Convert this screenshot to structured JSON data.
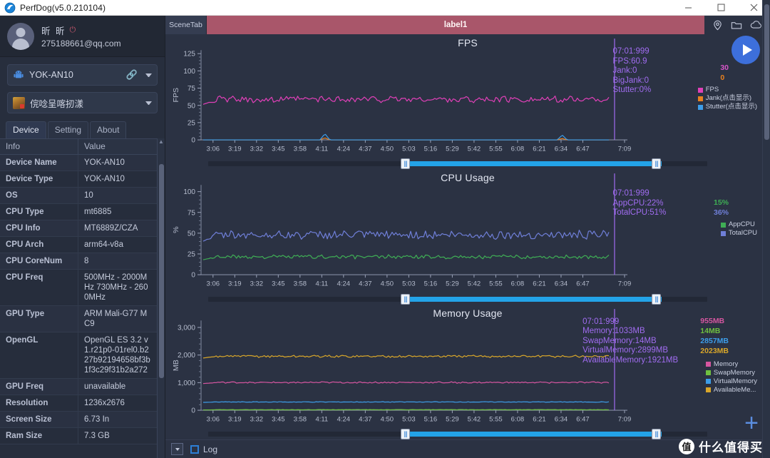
{
  "window": {
    "title": "PerfDog(v5.0.210104)",
    "minimize": "─",
    "maximize": "□",
    "close": "✕"
  },
  "sidebar": {
    "account": {
      "name": "昕 昕",
      "power_icon": "⏻",
      "email": "275188661@qq.com"
    },
    "device_select": {
      "label": "YOK-AN10",
      "link_icon": "🔗",
      "icon": "android-icon"
    },
    "app_select": {
      "label": "俒唸呈喀扨漾",
      "icon": "app-icon"
    },
    "tabs": [
      {
        "label": "Device",
        "active": true
      },
      {
        "label": "Setting",
        "active": false
      },
      {
        "label": "About",
        "active": false
      }
    ],
    "table": {
      "headers": [
        "Info",
        "Value"
      ],
      "rows": [
        {
          "info": "Device Name",
          "value": "YOK-AN10"
        },
        {
          "info": "Device Type",
          "value": "YOK-AN10"
        },
        {
          "info": "OS",
          "value": "10"
        },
        {
          "info": "CPU Type",
          "value": "mt6885"
        },
        {
          "info": "CPU Info",
          "value": "MT6889Z/CZA"
        },
        {
          "info": "CPU Arch",
          "value": "arm64-v8a"
        },
        {
          "info": "CPU CoreNum",
          "value": "8"
        },
        {
          "info": "CPU Freq",
          "value": "500MHz - 2000MHz 730MHz - 2600MHz"
        },
        {
          "info": "GPU Type",
          "value": "ARM Mali-G77 MC9"
        },
        {
          "info": "OpenGL",
          "value": "OpenGL ES 3.2 v1.r21p0-01rel0.b227b92194658bf3b1f3c29f31b2a272"
        },
        {
          "info": "GPU Freq",
          "value": "unavailable"
        },
        {
          "info": "Resolution",
          "value": "1236x2676"
        },
        {
          "info": "Screen Size",
          "value": "6.73 In"
        },
        {
          "info": "Ram Size",
          "value": "7.3 GB"
        }
      ]
    }
  },
  "main": {
    "scene_tab": "SceneTab",
    "label_tab": "label1",
    "toolbar_icons": [
      "location-icon",
      "folder-icon",
      "cloud-icon"
    ],
    "play_button": "play-icon",
    "add_button": "+"
  },
  "statusbar": {
    "dropdown": "dropdown-icon",
    "log_label": "Log",
    "log_checked": false
  },
  "watermark": {
    "mark": "值",
    "text": "什么值得买"
  },
  "chart_data": [
    {
      "type": "line",
      "title": "FPS",
      "ylabel": "FPS",
      "xlabel": "",
      "ylim": [
        0,
        130
      ],
      "yticks": [
        0,
        25,
        50,
        75,
        100,
        125
      ],
      "xticks": [
        "3:06",
        "3:19",
        "3:32",
        "3:45",
        "3:58",
        "4:11",
        "4:24",
        "4:37",
        "4:50",
        "5:03",
        "5:16",
        "5:29",
        "5:42",
        "5:55",
        "6:08",
        "6:21",
        "6:34",
        "6:47",
        "7:09"
      ],
      "cursor": {
        "lines": [
          "07:01:999",
          "FPS:60.9",
          "Jank:0",
          "BigJank:0",
          "Stutter:0%"
        ],
        "color": "#a06cf0"
      },
      "legend_values": [
        {
          "text": "30",
          "color": "#d556c8"
        },
        {
          "text": "0",
          "color": "#e8811f"
        }
      ],
      "legend": [
        {
          "name": "FPS",
          "color": "#e040b8"
        },
        {
          "name": "Jank(点击显示)",
          "color": "#e8811f"
        },
        {
          "name": "Stutter(点击显示)",
          "color": "#3d9de8"
        }
      ],
      "series": [
        {
          "name": "FPS",
          "color": "#e040b8",
          "mean": 58.5,
          "min": 52,
          "max": 62
        },
        {
          "name": "Jank",
          "color": "#e8811f",
          "mean": 0,
          "spikes": [
            {
              "x": 0.3,
              "y": 3
            },
            {
              "x": 0.885,
              "y": 2
            }
          ]
        },
        {
          "name": "Stutter",
          "color": "#3d9de8",
          "mean": 0,
          "spikes": [
            {
              "x": 0.3,
              "y": 9
            },
            {
              "x": 0.885,
              "y": 7
            }
          ]
        }
      ]
    },
    {
      "type": "line",
      "title": "CPU Usage",
      "ylabel": "%",
      "xlabel": "",
      "ylim": [
        0,
        108
      ],
      "yticks": [
        0,
        25,
        50,
        75,
        100
      ],
      "xticks": [
        "3:06",
        "3:19",
        "3:32",
        "3:45",
        "3:58",
        "4:11",
        "4:24",
        "4:37",
        "4:50",
        "5:03",
        "5:16",
        "5:29",
        "5:42",
        "5:55",
        "6:08",
        "6:21",
        "6:34",
        "6:47",
        "7:09"
      ],
      "cursor": {
        "lines": [
          "07:01:999",
          "AppCPU:22%",
          "TotalCPU:51%"
        ],
        "color": "#a06cf0"
      },
      "legend_values": [
        {
          "text": "15%",
          "color": "#3fae55"
        },
        {
          "text": "36%",
          "color": "#6f7fd8"
        }
      ],
      "legend": [
        {
          "name": "AppCPU",
          "color": "#3fae55"
        },
        {
          "name": "TotalCPU",
          "color": "#6f7fd8"
        }
      ],
      "series": [
        {
          "name": "AppCPU",
          "color": "#3fae55",
          "mean": 21.5,
          "min": 19,
          "max": 24
        },
        {
          "name": "TotalCPU",
          "color": "#6f7fd8",
          "mean": 48,
          "min": 43,
          "max": 54
        }
      ]
    },
    {
      "type": "line",
      "title": "Memory Usage",
      "ylabel": "MB",
      "xlabel": "",
      "ylim": [
        0,
        3250
      ],
      "yticks": [
        0,
        1000,
        2000,
        3000
      ],
      "ytick_labels": [
        "0",
        "1,000",
        "2,000",
        "3,000"
      ],
      "xticks": [
        "3:06",
        "3:19",
        "3:32",
        "3:45",
        "3:58",
        "4:11",
        "4:24",
        "4:37",
        "4:50",
        "5:03",
        "5:16",
        "5:29",
        "5:42",
        "5:55",
        "6:08",
        "6:21",
        "6:34",
        "6:47",
        "7:09"
      ],
      "cursor": {
        "lines": [
          "07:01:999",
          "Memory:1033MB",
          "SwapMemory:14MB",
          "VirtualMemory:2899MB",
          "AvailableMemory:1921MB"
        ],
        "color": "#a06cf0"
      },
      "legend_values": [
        {
          "text": "955MB",
          "color": "#d556a0"
        },
        {
          "text": "14MB",
          "color": "#6fc040"
        },
        {
          "text": "2857MB",
          "color": "#3d9de8"
        },
        {
          "text": "2023MB",
          "color": "#d8a62a"
        }
      ],
      "legend": [
        {
          "name": "Memory",
          "color": "#d556a0"
        },
        {
          "name": "SwapMemory",
          "color": "#6fc040"
        },
        {
          "name": "VirtualMemory",
          "color": "#3d9de8"
        },
        {
          "name": "AvailableMe...",
          "color": "#d8a62a"
        }
      ],
      "series": [
        {
          "name": "Memory",
          "color": "#d556a0",
          "mean": 1005,
          "min": 985,
          "max": 1040
        },
        {
          "name": "SwapMemory",
          "color": "#6fc040",
          "mean": 20,
          "min": 14,
          "max": 26
        },
        {
          "name": "VirtualMemory",
          "color": "#3d9de8",
          "mean": 300,
          "min": 290,
          "max": 312
        },
        {
          "name": "AvailableMemory",
          "color": "#d8a62a",
          "mean": 1955,
          "min": 1900,
          "max": 1990
        }
      ]
    }
  ]
}
